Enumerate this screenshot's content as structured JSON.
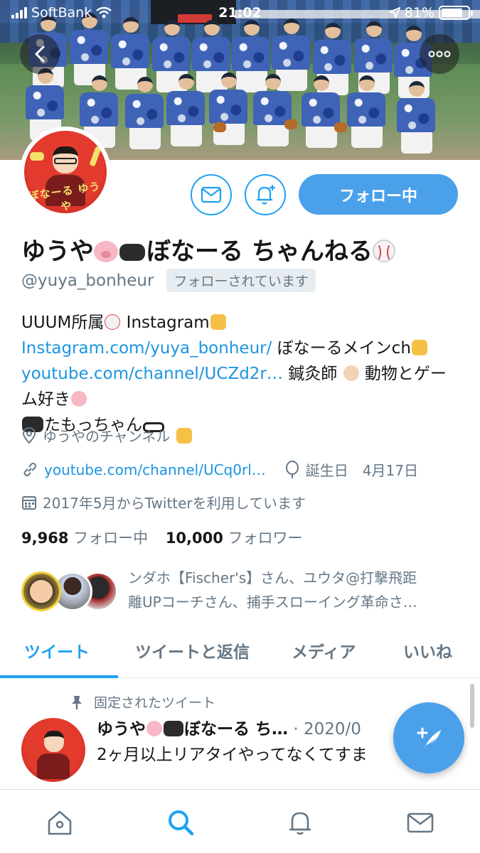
{
  "status_bar": {
    "carrier": "SoftBank",
    "time": "21:02",
    "battery_percent": "81%",
    "battery_level": 0.81
  },
  "profile": {
    "display_name_part1": "ゆうや",
    "display_name_part2": "ぼなーる ちゃんねる",
    "handle": "@yuya_bonheur",
    "follows_you": "フォローされています",
    "follow_button": "フォロー中",
    "avatar_text": "ぼなーる ゆうや"
  },
  "bio": {
    "t1": "UUUM所属",
    "t2": " Instagram",
    "link1": "Instagram.com/yuya_bonheur/",
    "t3": " ぼなーるメインch",
    "link2": "youtube.com/channel/UCZd2r…",
    "t4": " 鍼灸師",
    "t5": " 動物とゲーム好き",
    "t6": "たもっちゃん"
  },
  "meta": {
    "location": "ゆうやのチャンネル",
    "url": "youtube.com/channel/UCq0rl…",
    "birthday_label": "誕生日",
    "birthday": "4月17日",
    "joined": "2017年5月からTwitterを利用しています"
  },
  "counts": {
    "following_count": "9,968",
    "following_label": "フォロー中",
    "followers_count": "10,000",
    "followers_label": "フォロワー"
  },
  "known_followers": {
    "line1": "ンダホ【Fischer's】さん、ユウタ@打撃飛距",
    "line2": "離UPコーチさん、捕手スローイング革命さ…"
  },
  "tabs": [
    {
      "label": "ツイート"
    },
    {
      "label": "ツイートと返信"
    },
    {
      "label": "メディア"
    },
    {
      "label": "いいね"
    }
  ],
  "tweet": {
    "pinned_label": "固定されたツイート",
    "name_part1": "ゆうや",
    "name_part2": "ぼなーる ち…",
    "date": "· 2020/0",
    "text": "2ヶ月以上リアタイやってなくてすま"
  },
  "colors": {
    "accent": "#1da1f2",
    "follow_button": "#4aa1ea",
    "muted_text": "#657786"
  },
  "icons": {
    "back": "back-arrow-icon",
    "more": "more-icon",
    "message": "envelope-icon",
    "notify": "bell-plus-icon",
    "location": "location-pin-icon",
    "link": "link-icon",
    "birthday": "balloon-icon",
    "calendar": "calendar-icon",
    "pin": "pin-icon",
    "compose": "compose-feather-icon",
    "nav": [
      "home-icon",
      "search-icon",
      "bell-icon",
      "mail-icon"
    ]
  }
}
